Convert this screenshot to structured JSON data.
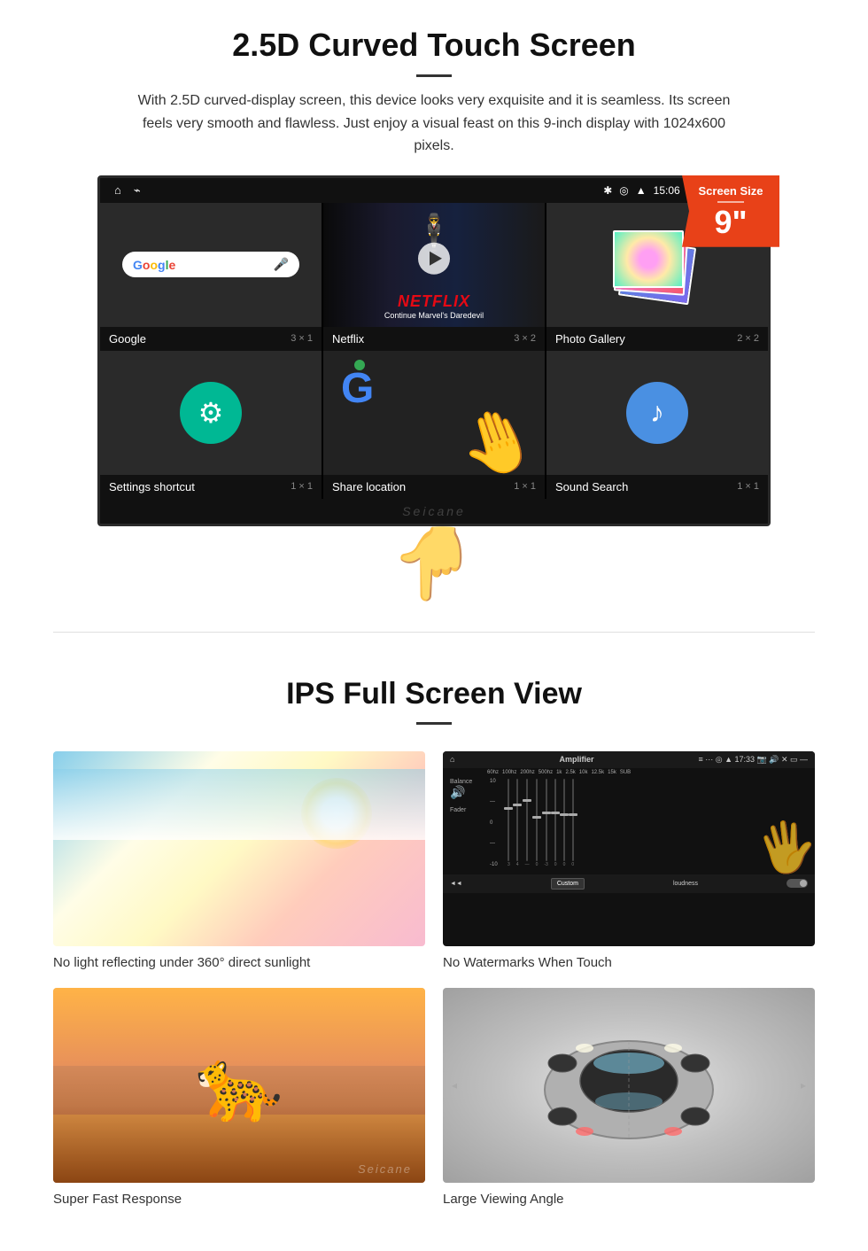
{
  "section1": {
    "title": "2.5D Curved Touch Screen",
    "description": "With 2.5D curved-display screen, this device looks very exquisite and it is seamless. Its screen feels very smooth and flawless. Just enjoy a visual feast on this 9-inch display with 1024x600 pixels.",
    "badge": {
      "title": "Screen Size",
      "size": "9\""
    },
    "status_bar": {
      "time": "15:06"
    },
    "apps": [
      {
        "name": "Google",
        "grid": "3 × 1"
      },
      {
        "name": "Netflix",
        "grid": "3 × 2"
      },
      {
        "name": "Photo Gallery",
        "grid": "2 × 2"
      },
      {
        "name": "Settings shortcut",
        "grid": "1 × 1"
      },
      {
        "name": "Share location",
        "grid": "1 × 1"
      },
      {
        "name": "Sound Search",
        "grid": "1 × 1"
      }
    ],
    "netflix_text": "NETFLIX",
    "netflix_sub": "Continue Marvel's Daredevil",
    "watermark": "Seicane"
  },
  "section2": {
    "title": "IPS Full Screen View",
    "items": [
      {
        "caption": "No light reflecting under 360° direct sunlight"
      },
      {
        "caption": "No Watermarks When Touch"
      },
      {
        "caption": "Super Fast Response"
      },
      {
        "caption": "Large Viewing Angle"
      }
    ],
    "amp": {
      "title": "Amplifier",
      "time": "17:33",
      "labels": [
        "Balance",
        "Fader"
      ],
      "footer_left": "◄◄",
      "custom_label": "Custom",
      "loudness_label": "loudness"
    }
  }
}
